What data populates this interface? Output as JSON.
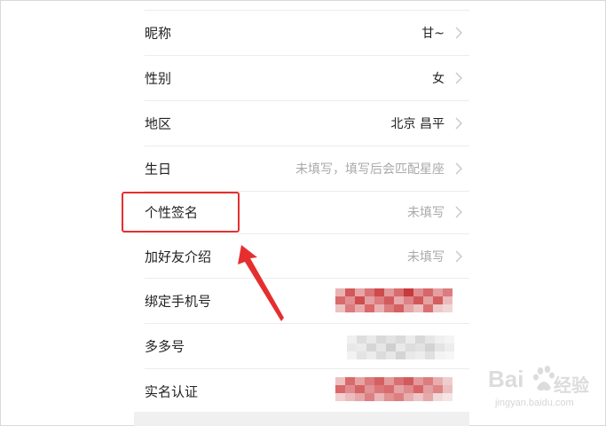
{
  "profile_rows": [
    {
      "label": "昵称",
      "value": "甘~",
      "muted": false
    },
    {
      "label": "性别",
      "value": "女",
      "muted": false
    },
    {
      "label": "地区",
      "value": "北京 昌平",
      "muted": false
    },
    {
      "label": "生日",
      "value": "未填写，填写后会匹配星座",
      "muted": true
    },
    {
      "label": "个性签名",
      "value": "未填写",
      "muted": true
    },
    {
      "label": "加好友介绍",
      "value": "未填写",
      "muted": true
    },
    {
      "label": "绑定手机号",
      "value": "",
      "muted": false
    },
    {
      "label": "多多号",
      "value": "",
      "muted": false
    },
    {
      "label": "实名认证",
      "value": "",
      "muted": false
    }
  ],
  "icons": {
    "row_chevron": "chevron-right-icon",
    "annotation_arrow": "red-arrow-icon"
  },
  "colors": {
    "highlight": "#e52f2f",
    "muted_text": "#a9a9a9",
    "redacted_red": "#d9686a",
    "redacted_gray": "#cdcdcd"
  },
  "watermark": {
    "brand": "Bai",
    "cn": "经验",
    "url": "jingyan.baidu.com"
  }
}
